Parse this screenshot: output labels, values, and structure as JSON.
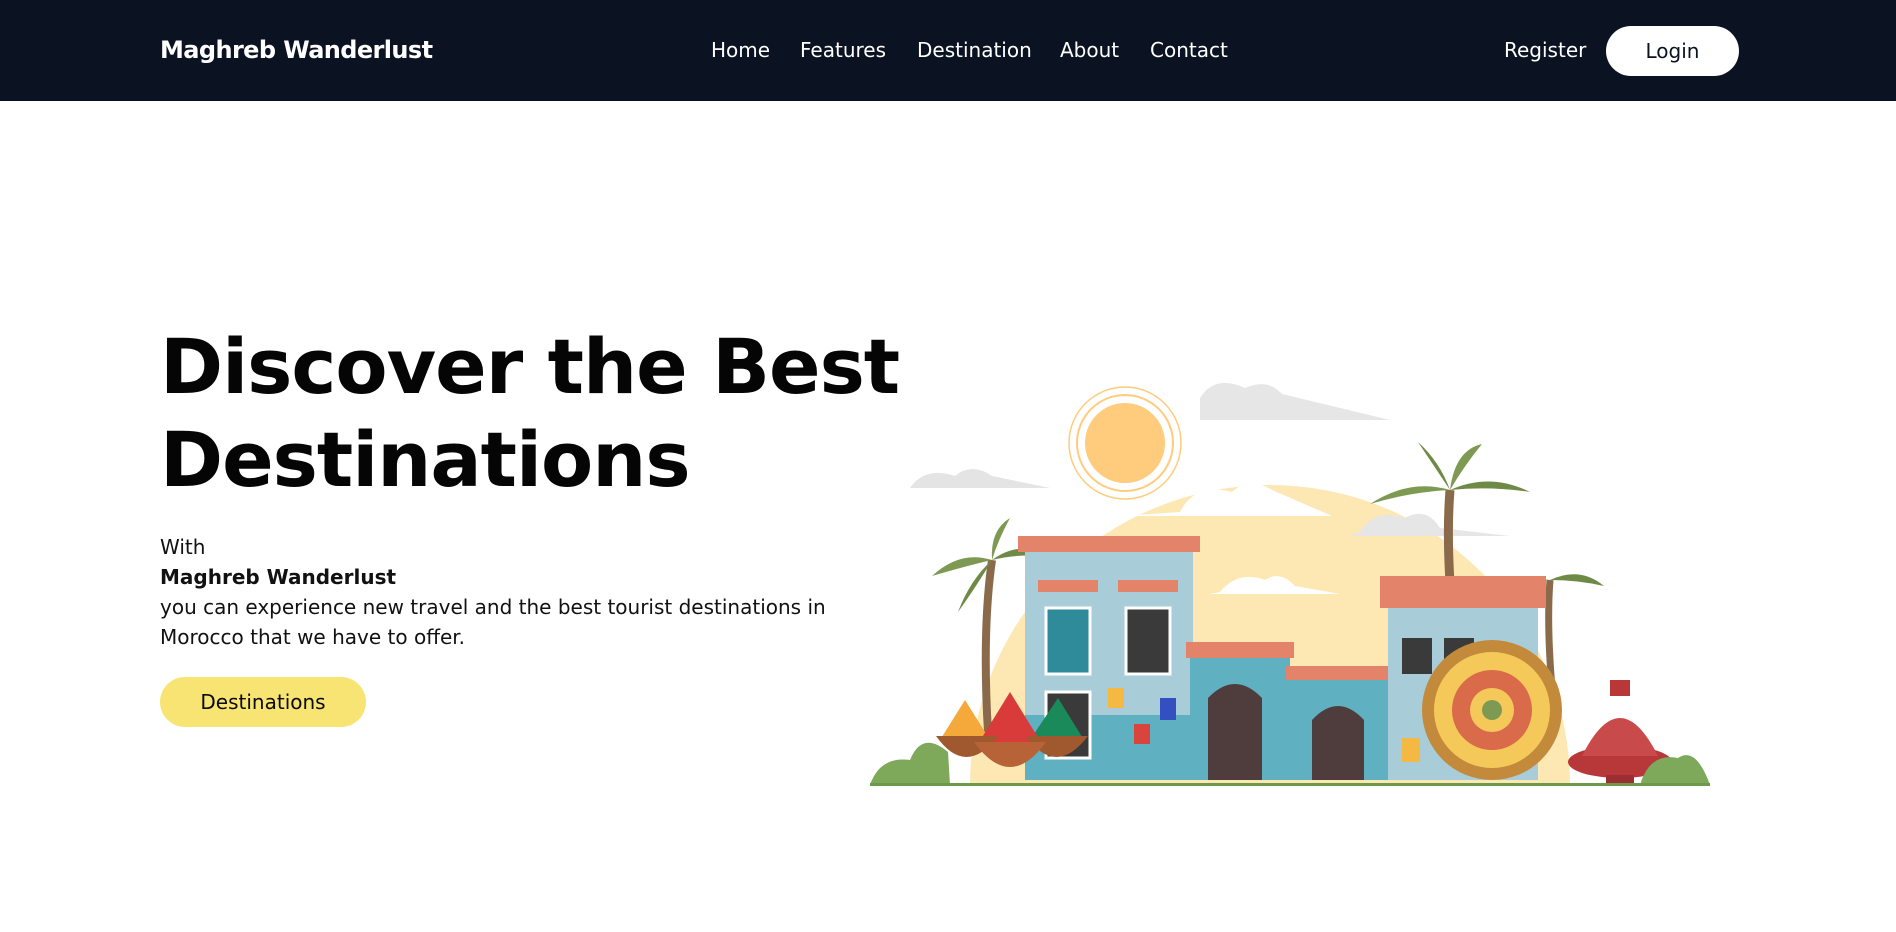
{
  "nav": {
    "brand": "Maghreb Wanderlust",
    "links": [
      "Home",
      "Features",
      "Destination",
      "About",
      "Contact"
    ],
    "register_label": "Register",
    "login_label": "Login"
  },
  "hero": {
    "title_line1": "Discover the Best",
    "title_line2": "Destinations",
    "intro": "With",
    "brand_bold": "Maghreb Wanderlust",
    "description_line1": "you can experience new travel and the best tourist destinations in",
    "description_line2": "Morocco that we have to offer.",
    "cta_label": "Destinations"
  },
  "colors": {
    "navbar_bg": "#0b1221",
    "cta_bg": "#f7e473",
    "login_bg": "#ffffff"
  }
}
